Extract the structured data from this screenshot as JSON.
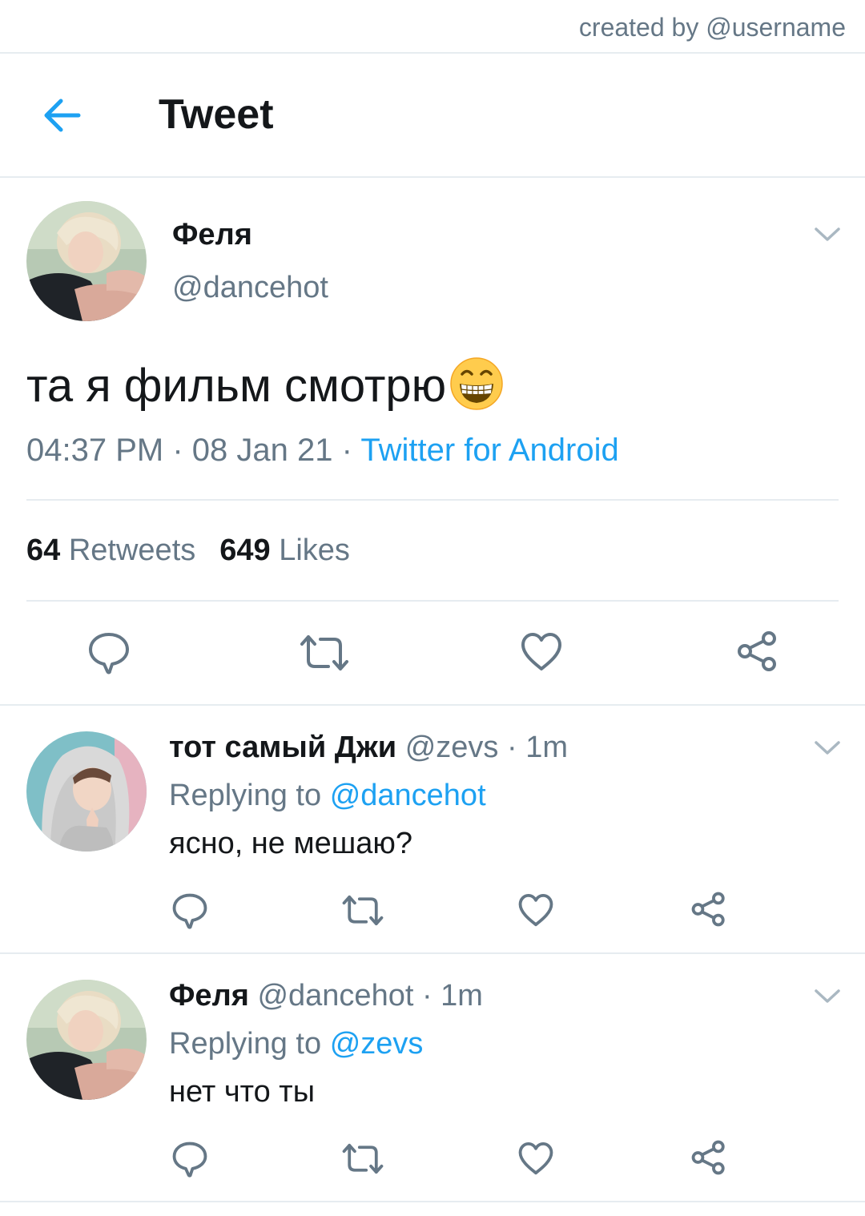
{
  "credit": "created by @username",
  "header": {
    "title": "Tweet",
    "back_icon": "arrow-left-icon"
  },
  "main_tweet": {
    "name": "Феля",
    "handle": "@dancehot",
    "text": "та я фильм смотрю",
    "emoji": "grinning-face-emoji",
    "time": "04:37 PM",
    "date": "08 Jan 21",
    "source": "Twitter for Android",
    "separator": "·",
    "retweets_count": "64",
    "retweets_label": "Retweets",
    "likes_count": "649",
    "likes_label": "Likes"
  },
  "replies": [
    {
      "name": "тот самый Джи",
      "handle": "@zevs",
      "time": "· 1m",
      "replying_prefix": "Replying to",
      "replying_to": "@dancehot",
      "text": "ясно, не мешаю?"
    },
    {
      "name": "Феля",
      "handle": "@dancehot",
      "time": "· 1m",
      "replying_prefix": "Replying to",
      "replying_to": "@zevs",
      "text": "нет что ты"
    }
  ],
  "action_icons": [
    "reply-icon",
    "retweet-icon",
    "like-icon",
    "share-icon"
  ],
  "colors": {
    "accent": "#1da1f2",
    "secondary_text": "#657786",
    "icon": "#657786",
    "divider": "#e6ecf0"
  }
}
